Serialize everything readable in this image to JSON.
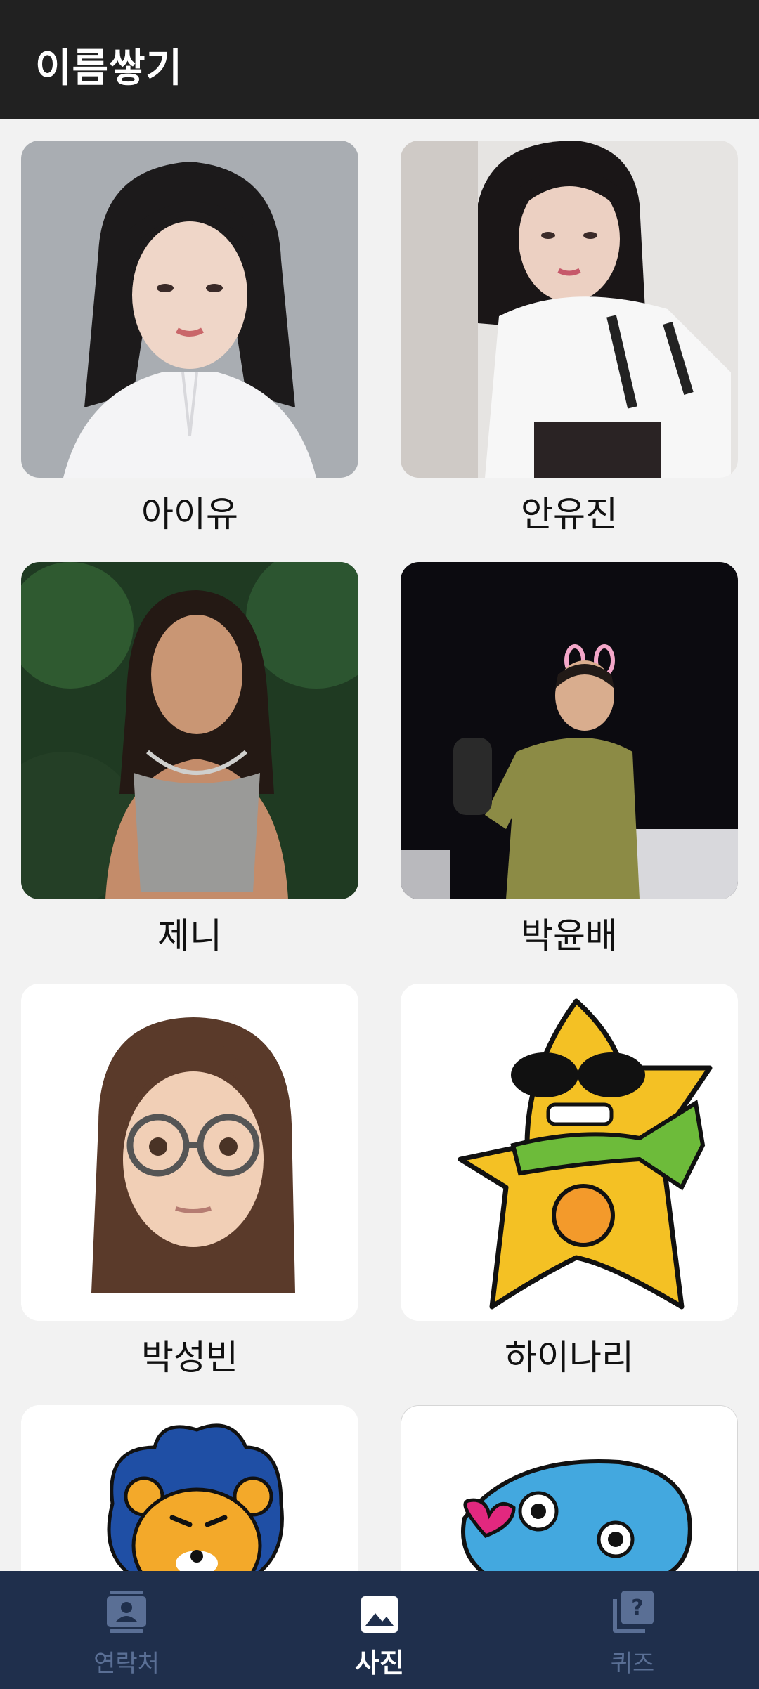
{
  "app": {
    "title": "이름쌓기"
  },
  "contacts": [
    {
      "name": "아이유"
    },
    {
      "name": "안유진"
    },
    {
      "name": "제니"
    },
    {
      "name": "박윤배"
    },
    {
      "name": "박성빈"
    },
    {
      "name": "하이나리"
    },
    {
      "name": ""
    },
    {
      "name": ""
    }
  ],
  "bottom_nav": {
    "items": [
      {
        "label": "연락처",
        "icon": "contact-card-icon",
        "active": false
      },
      {
        "label": "사진",
        "icon": "image-icon",
        "active": true
      },
      {
        "label": "퀴즈",
        "icon": "quiz-icon",
        "active": false
      }
    ]
  },
  "colors": {
    "appbar": "#212121",
    "background": "#f2f2f2",
    "bottom_nav": "#1f2f4c",
    "nav_active": "#ffffff",
    "nav_inactive": "#5a6f95"
  }
}
